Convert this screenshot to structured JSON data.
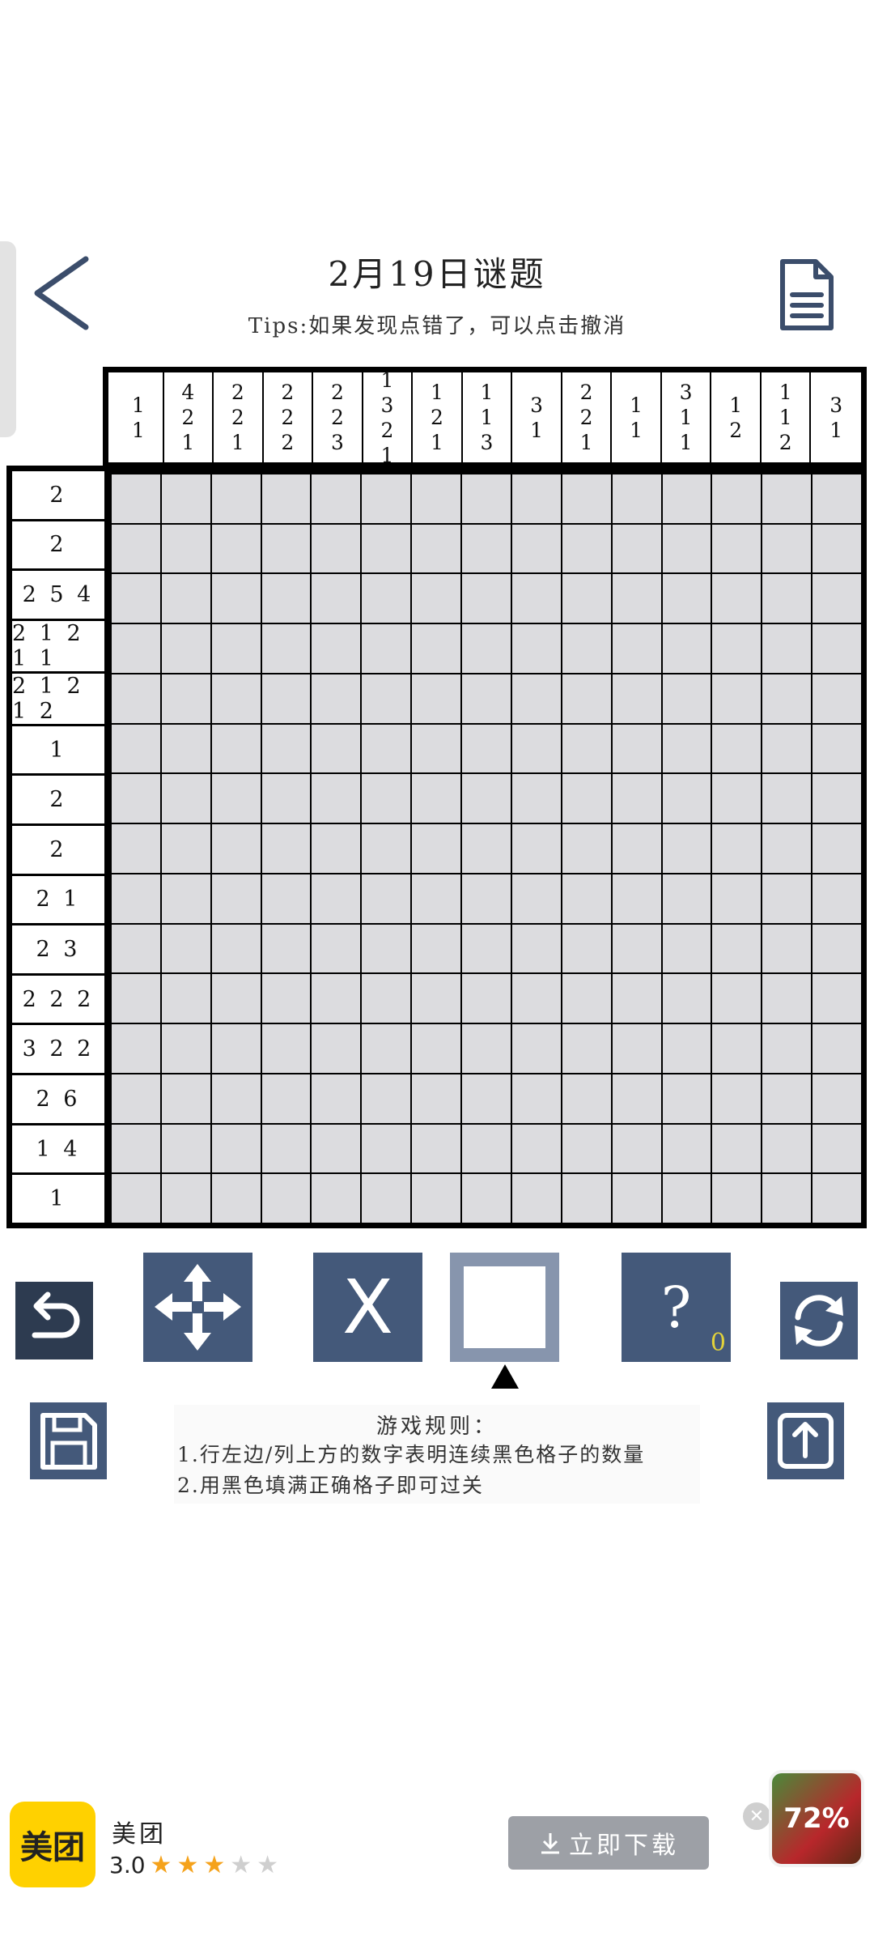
{
  "header": {
    "title": "2月19日谜题",
    "tips": "Tips:如果发现点错了，可以点击撤消"
  },
  "puzzle": {
    "col_clues": [
      "1\n1",
      "4\n2\n1",
      "2\n2\n1",
      "2\n2\n2",
      "2\n2\n3",
      "1\n3\n2\n1",
      "1\n2\n1",
      "1\n1\n3",
      "3\n1",
      "2\n2\n1",
      "1\n1",
      "3\n1\n1",
      "1\n2",
      "1\n1\n2",
      "3\n1"
    ],
    "row_clues": [
      "2",
      "2",
      "2 5 4",
      "2 1 2 1 1",
      "2 1 2 1 2",
      "1",
      "2",
      "2",
      "2 1",
      "2 3",
      "2 2 2",
      "3 2 2",
      "2 6",
      "1 4",
      "1"
    ],
    "size": 15
  },
  "tools": {
    "hint_count": "0",
    "cross_symbol": "X",
    "hint_symbol": "?"
  },
  "rules": {
    "title": "游戏规则：",
    "line1": "1.行左边/列上方的数字表明连续黑色格子的数量",
    "line2": "2.用黑色填满正确格子即可过关"
  },
  "ad": {
    "app_name": "美团",
    "logo_text": "美团",
    "rating": "3.0",
    "stars_filled": 3,
    "stars_total": 5,
    "download_label": "立即下载",
    "game_badge": "72%"
  }
}
